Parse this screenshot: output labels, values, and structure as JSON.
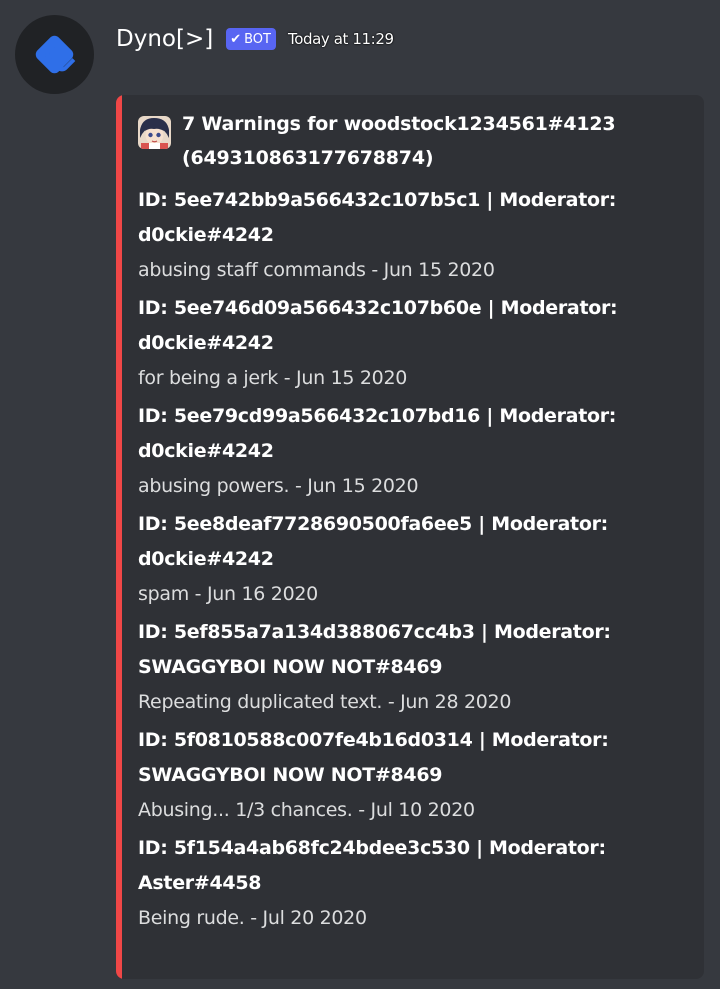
{
  "message": {
    "username": "Dyno[>]",
    "bot_tag": {
      "check": "✔",
      "label": "BOT"
    },
    "timestamp": "Today at 11:29",
    "avatar_icon": "dyno-chevron-icon",
    "embed": {
      "stripe_color": "#f04747",
      "author": {
        "icon": "anime-avatar-icon",
        "text": "7 Warnings for woodstock1234561#4123 (649310863177678874)"
      },
      "warnings": [
        {
          "id": "5ee742bb9a566432c107b5c1",
          "moderator": "d0ckie#4242",
          "title_line1": "ID: 5ee742bb9a566432c107b5c1 | Moderator:",
          "title_line2": "d0ckie#4242",
          "reason": "abusing staff commands - Jun 15 2020"
        },
        {
          "id": "5ee746d09a566432c107b60e",
          "moderator": "d0ckie#4242",
          "title_line1": "ID: 5ee746d09a566432c107b60e | Moderator:",
          "title_line2": "d0ckie#4242",
          "reason": "for being a jerk - Jun 15 2020"
        },
        {
          "id": "5ee79cd99a566432c107bd16",
          "moderator": "d0ckie#4242",
          "title_line1": "ID: 5ee79cd99a566432c107bd16 | Moderator:",
          "title_line2": "d0ckie#4242",
          "reason": "abusing powers. - Jun 15 2020"
        },
        {
          "id": "5ee8deaf7728690500fa6ee5",
          "moderator": "d0ckie#4242",
          "title_line1": "ID: 5ee8deaf7728690500fa6ee5 | Moderator:",
          "title_line2": "d0ckie#4242",
          "reason": "spam - Jun 16 2020"
        },
        {
          "id": "5ef855a7a134d388067cc4b3",
          "moderator": "SWAGGYBOI NOW NOT#8469",
          "title_line1": "ID: 5ef855a7a134d388067cc4b3 | Moderator:",
          "title_line2": "SWAGGYBOI NOW NOT#8469",
          "reason": "Repeating duplicated text. - Jun 28 2020"
        },
        {
          "id": "5f0810588c007fe4b16d0314",
          "moderator": "SWAGGYBOI NOW NOT#8469",
          "title_line1": "ID: 5f0810588c007fe4b16d0314 | Moderator:",
          "title_line2": "SWAGGYBOI NOW NOT#8469",
          "reason": "Abusing... 1/3 chances. - Jul 10 2020"
        },
        {
          "id": "5f154a4ab68fc24bdee3c530",
          "moderator": "Aster#4458",
          "title_line1": "ID: 5f154a4ab68fc24bdee3c530 | Moderator:",
          "title_line2": "Aster#4458",
          "reason": "Being rude. - Jul 20 2020"
        }
      ]
    }
  },
  "colors": {
    "background": "#36393f",
    "embed_background": "#2f3136",
    "bot_tag": "#5865f2",
    "avatar_accent": "#2f6fe8"
  }
}
